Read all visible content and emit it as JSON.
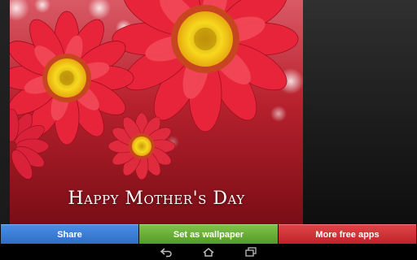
{
  "wallpaper": {
    "greeting": "Happy Mother's Day",
    "subject": "red-gerbera-flowers"
  },
  "actions": {
    "share_label": "Share",
    "set_wallpaper_label": "Set as wallpaper",
    "more_apps_label": "More free apps"
  },
  "navbar": {
    "icons": [
      "back-icon",
      "home-icon",
      "recent-apps-icon"
    ]
  },
  "colors": {
    "share": "#3b7fd8",
    "set_wallpaper": "#6bb23a",
    "more_apps": "#d3353a",
    "petal": "#e8243a",
    "flower_center": "#f5d21a"
  }
}
